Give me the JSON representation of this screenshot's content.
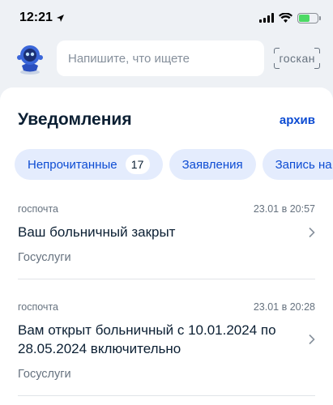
{
  "status_bar": {
    "time": "12:21"
  },
  "search": {
    "placeholder": "Напишите, что ищете",
    "scan_label": "госкан"
  },
  "header": {
    "title": "Уведомления",
    "archive_label": "архив"
  },
  "chips": [
    {
      "label": "Непрочитанные",
      "count": "17"
    },
    {
      "label": "Заявления"
    },
    {
      "label": "Запись на"
    }
  ],
  "notifications": [
    {
      "category": "госпочта",
      "timestamp": "23.01 в 20:57",
      "title": "Ваш больничный закрыт",
      "source": "Госуслуги"
    },
    {
      "category": "госпочта",
      "timestamp": "23.01 в 20:28",
      "title": "Вам открыт больничный с 10.01.2024 по 28.05.2024 включительно",
      "source": "Госуслуги"
    }
  ],
  "colors": {
    "accent": "#0d4cd3",
    "chip_bg": "#e4ecfd",
    "page_bg": "#eef1f5",
    "battery": "#4cd964"
  },
  "icons": [
    "location-arrow-icon",
    "signal-icon",
    "wifi-icon",
    "battery-icon",
    "robot-avatar-icon",
    "scan-icon",
    "chevron-right-icon"
  ]
}
